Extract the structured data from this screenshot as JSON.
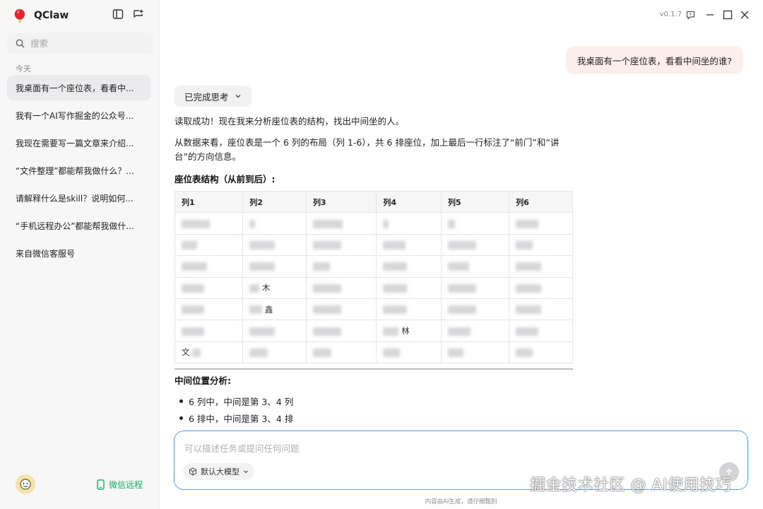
{
  "app": {
    "name": "QClaw",
    "version": "v0.1.7"
  },
  "sidebar": {
    "search_placeholder": "搜索",
    "section_today": "今天",
    "conversations": [
      {
        "title": "我桌面有一个座位表，看看中..."
      },
      {
        "title": "我有一个AI写作掘金的公众号..."
      },
      {
        "title": "我现在需要写一篇文章来介绍..."
      },
      {
        "title": "“文件整理”都能帮我做什么？..."
      },
      {
        "title": "请解释什么是skill？说明如何..."
      },
      {
        "title": "“手机远程办公”都能帮我做什..."
      },
      {
        "title": "来自微信客服号"
      }
    ],
    "wechat_remote": "微信远程"
  },
  "chat": {
    "user_message": "我桌面有一个座位表，看看中间坐的谁?",
    "thinking_label": "已完成思考",
    "para1": "读取成功！现在我来分析座位表的结构，找出中间坐的人。",
    "para2_line1": "从数据来看，座位表是一个 6 列的布局（列 1-6），共 6 排座位，加上最后一行标注了“前门”和“讲",
    "para2_line2": "台”的方向信息。",
    "table_heading": "座位表结构（从前到后）:",
    "table": {
      "headers": [
        "列1",
        "列2",
        "列3",
        "列4",
        "列5",
        "列6"
      ],
      "rows": [
        [
          "",
          "",
          "",
          "",
          "",
          ""
        ],
        [
          "",
          "",
          "",
          "",
          "",
          ""
        ],
        [
          "",
          "",
          "",
          "",
          "",
          ""
        ],
        [
          "",
          "木",
          "",
          "",
          "",
          ""
        ],
        [
          "",
          "鑫",
          "",
          "",
          "",
          ""
        ],
        [
          "",
          "",
          "",
          "林",
          "",
          ""
        ],
        [
          "文",
          "",
          "",
          "",
          "",
          ""
        ]
      ]
    },
    "analysis_heading": "中间位置分析:",
    "bullets": [
      "6 列中，中间是第 3、4 列",
      "6 排中，中间是第 3、4 排"
    ]
  },
  "composer": {
    "placeholder": "可以描述任务或提问任何问题",
    "model_label": "默认大模型"
  },
  "disclaimer": "内容由AI生成，请仔细甄别",
  "watermark": "掘金技术社区 @ AI使用技巧",
  "colors": {
    "accent_border": "#5aa0e8",
    "user_bubble": "#fdeeee",
    "wechat_green": "#20a862"
  }
}
